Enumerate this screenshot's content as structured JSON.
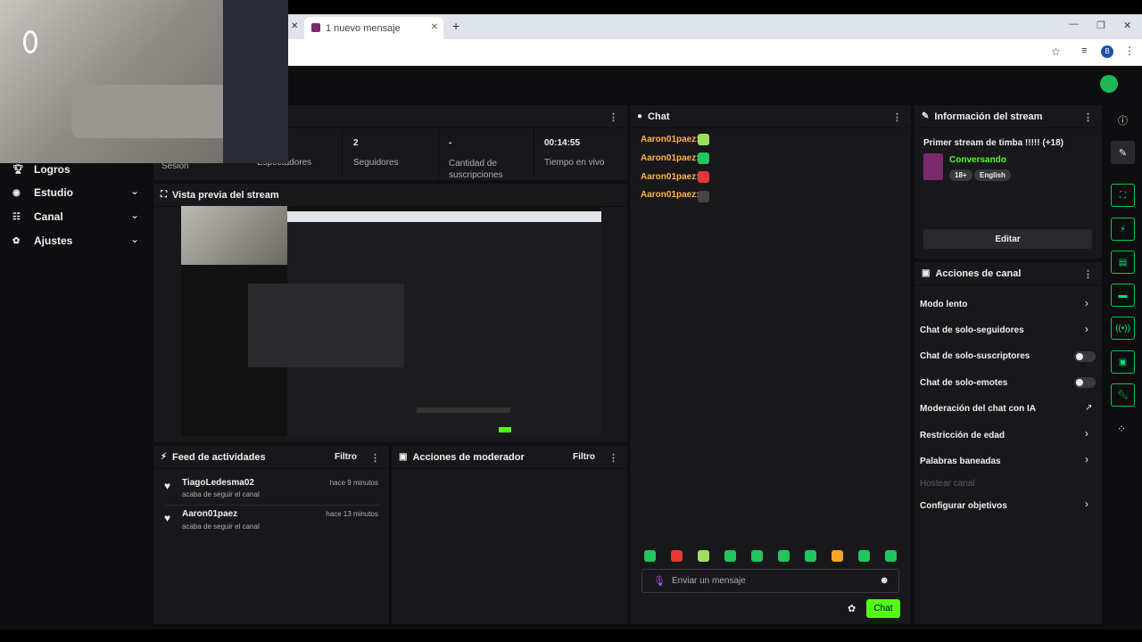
{
  "browser": {
    "tab_title": "1 nuevo mensaje",
    "close": "✕",
    "new_tab": "+",
    "win_min": "—",
    "win_max": "❐",
    "win_close": "✕"
  },
  "sidebar": {
    "items": [
      {
        "label": "Logros",
        "icon": "trophy-icon"
      },
      {
        "label": "Estudio",
        "icon": "studio-icon"
      },
      {
        "label": "Canal",
        "icon": "channel-icon"
      },
      {
        "label": "Ajustes",
        "icon": "gear-icon"
      }
    ]
  },
  "stats": {
    "session_label": "Sesión",
    "viewers_label": "Espectadores",
    "followers_value": "2",
    "followers_label": "Seguidores",
    "subs_value": "-",
    "subs_label": "Cantidad de suscripciones",
    "uptime_value": "00:14:55",
    "uptime_label": "Tiempo en vivo"
  },
  "preview": {
    "title": "Vista previa del stream"
  },
  "activity": {
    "title": "Feed de actividades",
    "filter": "Filtro",
    "items": [
      {
        "name": "TiagoLedesma02",
        "sub": "acaba de seguir el canal",
        "time": "hace 9 minutos"
      },
      {
        "name": "Aaron01paez",
        "sub": "acaba de seguir el canal",
        "time": "hace 13 minutos"
      }
    ]
  },
  "moderator": {
    "title": "Acciones de moderador",
    "filter": "Filtro"
  },
  "chat": {
    "title": "Chat",
    "messages": [
      {
        "user": "Aaron01paez:"
      },
      {
        "user": "Aaron01paez:"
      },
      {
        "user": "Aaron01paez:"
      },
      {
        "user": "Aaron01paez:"
      }
    ],
    "placeholder": "Enviar un mensaje",
    "send": "Chat"
  },
  "info": {
    "title": "Información del stream",
    "stream_title": "Primer stream de timba !!!!! (+18)",
    "category": "Conversando",
    "tags": [
      "18+",
      "English"
    ],
    "edit": "Editar"
  },
  "actions": {
    "title": "Acciones de canal",
    "items": [
      {
        "label": "Modo lento"
      },
      {
        "label": "Chat de solo-seguidores"
      },
      {
        "label": "Chat de solo-suscriptores"
      },
      {
        "label": "Chat de solo-emotes"
      },
      {
        "label": "Moderación del chat con IA"
      },
      {
        "label": "Restricción de edad"
      },
      {
        "label": "Palabras baneadas"
      },
      {
        "label": "Hostear canal"
      },
      {
        "label": "Configurar objetivos"
      }
    ]
  },
  "colors": {
    "accent": "#53fc18",
    "username": "#ffb347",
    "bg": "#0e0e10",
    "panel": "#18181b"
  }
}
